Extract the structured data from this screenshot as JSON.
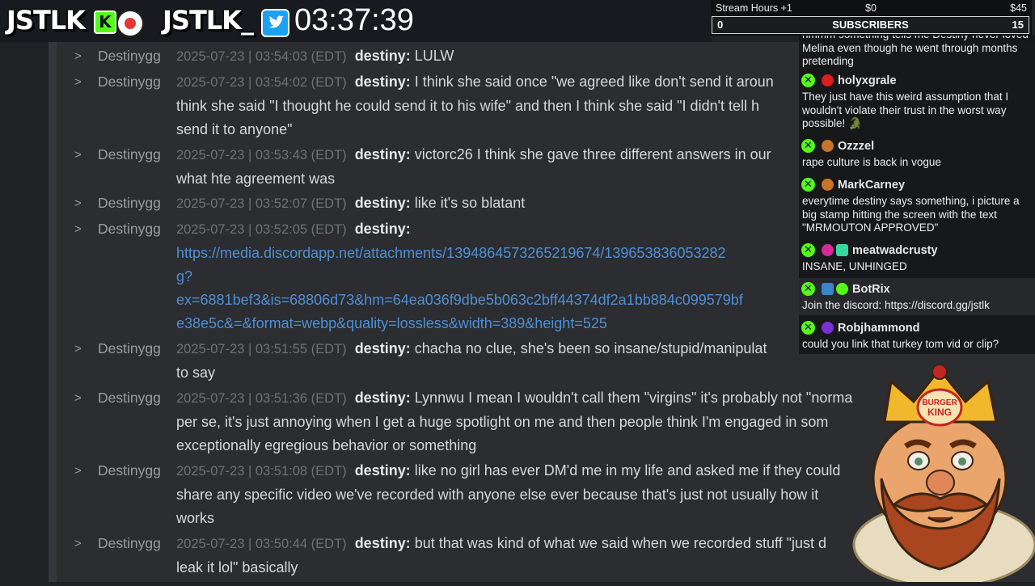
{
  "overlay": {
    "logo_left": "JSTLK",
    "logo_right": "JSTLK_",
    "kick_glyph": "K",
    "clock": "03:37:39"
  },
  "goal": {
    "hours_label": "Stream Hours +1",
    "money_start": "$0",
    "money_end": "$45",
    "min": "0",
    "label": "SUBSCRIBERS",
    "max": "15"
  },
  "log": {
    "chevron": ">",
    "messages": [
      {
        "channel": "Destinygg",
        "timestamp": "2025-07-23 | 03:54:03 (EDT)",
        "nick": "destiny:",
        "text": "LULW"
      },
      {
        "channel": "Destinygg",
        "timestamp": "2025-07-23 | 03:54:02 (EDT)",
        "nick": "destiny:",
        "text": "I think she said once \"we agreed like don't send it aroun",
        "cont": [
          "think she said \"I thought he could send it to his wife\" and then I think she said \"I didn't tell h",
          "send it to anyone\""
        ]
      },
      {
        "channel": "Destinygg",
        "timestamp": "2025-07-23 | 03:53:43 (EDT)",
        "nick": "destiny:",
        "text": "victorc26 I think she gave three different answers in our",
        "cont": [
          "what hte agreement was"
        ]
      },
      {
        "channel": "Destinygg",
        "timestamp": "2025-07-23 | 03:52:07 (EDT)",
        "nick": "destiny:",
        "text": "like it's so blatant"
      },
      {
        "channel": "Destinygg",
        "timestamp": "2025-07-23 | 03:52:05 (EDT)",
        "nick": "destiny:",
        "text": "",
        "link": [
          "https://media.discordapp.net/attachments/1394864573265219674/139653836053282",
          "g?",
          "ex=6881bef3&is=68806d73&hm=64ea036f9dbe5b063c2bff44374df2a1bb884c099579bf",
          "e38e5c&=&format=webp&quality=lossless&width=389&height=525"
        ]
      },
      {
        "channel": "Destinygg",
        "timestamp": "2025-07-23 | 03:51:55 (EDT)",
        "nick": "destiny:",
        "text": "chacha no clue, she's been so insane/stupid/manipulat",
        "cont": [
          "to say"
        ]
      },
      {
        "channel": "Destinygg",
        "timestamp": "2025-07-23 | 03:51:36 (EDT)",
        "nick": "destiny:",
        "text": "Lynnwu I mean I wouldn't call them \"virgins\" it's probably not \"norma",
        "cont": [
          "per se, it's just annoying when I get a huge spotlight on me and then people think I'm engaged in som",
          "exceptionally egregious behavior or something"
        ]
      },
      {
        "channel": "Destinygg",
        "timestamp": "2025-07-23 | 03:51:08 (EDT)",
        "nick": "destiny:",
        "text": "like no girl has ever DM'd me in my life and asked me if they could",
        "cont": [
          "share any specific video we've recorded with anyone else ever because that's just not usually how it",
          "works"
        ]
      },
      {
        "channel": "Destinygg",
        "timestamp": "2025-07-23 | 03:50:44 (EDT)",
        "nick": "destiny:",
        "text": "but that was kind of what we said when we recorded stuff \"just d",
        "cont": [
          "leak it lol\" basically"
        ]
      }
    ]
  },
  "chat": {
    "top_fragment": "hmmm something tells me Destiny never loved Melina even though he went through months pretending",
    "messages": [
      {
        "user": "holyxgrale",
        "text": "They just have this weird assumption that I wouldn't violate their trust in the worst way possible! 🐊",
        "avatar_color": "#d81e1e"
      },
      {
        "user": "Ozzzel",
        "text": "rape culture is back in vogue",
        "avatar_color": "#c9742a"
      },
      {
        "user": "MarkCarney",
        "text": "everytime destiny says something, i picture a big stamp hitting the screen with the text \"MRMOUTON APPROVED\"",
        "avatar_color": "#c9742a"
      },
      {
        "user": "meatwadcrusty",
        "text": "INSANE, UNHINGED",
        "avatar_color": "#d62a9a"
      },
      {
        "user": "BotRix",
        "text": "Join the discord: https://discord.gg/jstlk",
        "avatar_color": "#3a86c8"
      },
      {
        "user": "Robjhammond",
        "text": "could you link that turkey tom vid or clip?",
        "avatar_color": "#7b2fd6"
      }
    ]
  },
  "avatar": {
    "crown_text_top": "BURGER",
    "crown_text_bottom": "KING"
  },
  "colors": {
    "kick_green": "#53fc18",
    "twitter_blue": "#1da1f2",
    "link_blue": "#4f8fd6"
  }
}
